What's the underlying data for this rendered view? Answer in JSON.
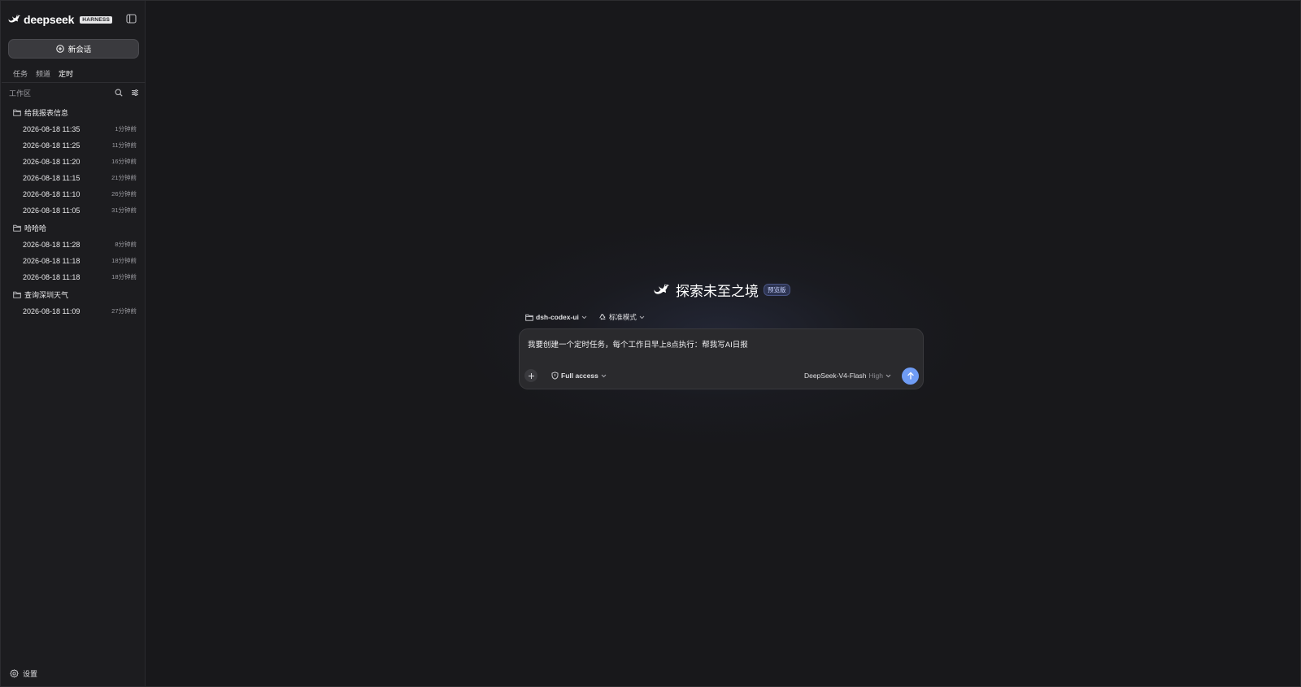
{
  "sidebar": {
    "brand": {
      "logo_text": "deepseek",
      "badge": "HARNESS"
    },
    "new_chat_label": "新会话",
    "tabs": [
      {
        "label": "任务",
        "active": false
      },
      {
        "label": "频道",
        "active": false
      },
      {
        "label": "定时",
        "active": true
      }
    ],
    "workspace_label": "工作区",
    "groups": [
      {
        "name": "给我报表信息",
        "items": [
          {
            "time": "2026-08-18 11:35",
            "ago": "1分钟前"
          },
          {
            "time": "2026-08-18 11:25",
            "ago": "11分钟前"
          },
          {
            "time": "2026-08-18 11:20",
            "ago": "16分钟前"
          },
          {
            "time": "2026-08-18 11:15",
            "ago": "21分钟前"
          },
          {
            "time": "2026-08-18 11:10",
            "ago": "26分钟前"
          },
          {
            "time": "2026-08-18 11:05",
            "ago": "31分钟前"
          }
        ]
      },
      {
        "name": "哈哈哈",
        "items": [
          {
            "time": "2026-08-18 11:28",
            "ago": "8分钟前"
          },
          {
            "time": "2026-08-18 11:18",
            "ago": "18分钟前"
          },
          {
            "time": "2026-08-18 11:18",
            "ago": "18分钟前"
          }
        ]
      },
      {
        "name": "查询深圳天气",
        "items": [
          {
            "time": "2026-08-18 11:09",
            "ago": "27分钟前"
          }
        ]
      }
    ],
    "settings_label": "设置"
  },
  "main": {
    "hero_title": "探索未至之境",
    "hero_badge": "预览版",
    "project": "dsh-codex-ui",
    "mode": "标准模式",
    "prompt_text": "我要创建一个定时任务，每个工作日早上8点执行：帮我写AI日报",
    "access": "Full access",
    "model": "DeepSeek-V4-Flash",
    "effort": "High"
  },
  "colors": {
    "accent": "#6f9cf5",
    "sidebar_bg": "#1c1c1f",
    "main_bg": "#18181b"
  },
  "icons": [
    "whale-logo-icon",
    "sidebar-toggle-icon",
    "plus-circle-icon",
    "search-icon",
    "filter-icon",
    "folder-icon",
    "gear-icon",
    "shield-icon",
    "chevron-down-icon",
    "arrow-up-icon",
    "recycle-icon"
  ]
}
